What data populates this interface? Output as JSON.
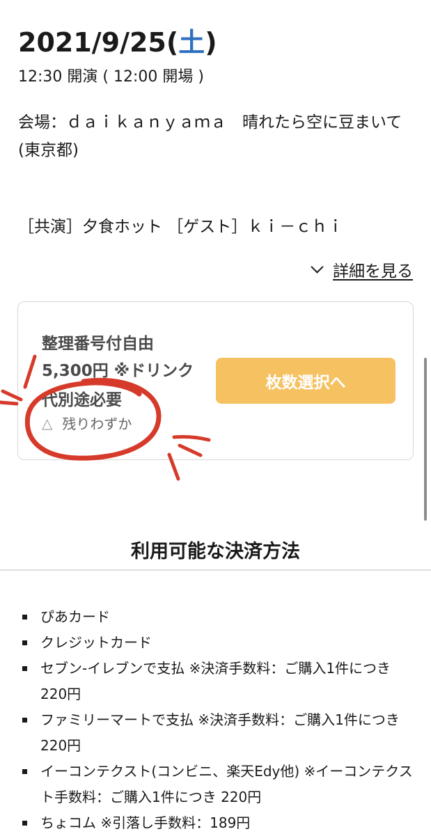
{
  "event": {
    "date_main": "2021/9/25(",
    "date_dow": "土",
    "date_close": ")",
    "time": "12:30 開演 ( 12:00 開場 )",
    "venue": "会場：ｄａｉｋａｎｙａｍａ　晴れたら空に豆まいて (東京都)",
    "cast": "［共演］夕食ホット ［ゲスト］ｋｉ－ｃｈｉ",
    "details_link": "詳細を見る"
  },
  "ticket": {
    "name": "整理番号付自由",
    "price": "5,300円 ※ドリンク代別途必要",
    "stock_icon": "△",
    "stock": "残りわずか",
    "button": "枚数選択へ"
  },
  "payment": {
    "title": "利用可能な決済方法",
    "methods": [
      "ぴあカード",
      "クレジットカード",
      "セブン-イレブンで支払 ※決済手数料：ご購入1件につき 220円",
      "ファミリーマートで支払 ※決済手数料：ご購入1件につき 220円",
      "イーコンテクスト(コンビニ、楽天Edy他) ※イーコンテクスト手数料：ご購入1件につき 220円",
      "ちょコム ※引落し手数料：189円"
    ]
  },
  "colors": {
    "accent_blue": "#2f6fbf",
    "button_bg": "#f5c161",
    "annotation_red": "#d63a2a"
  }
}
